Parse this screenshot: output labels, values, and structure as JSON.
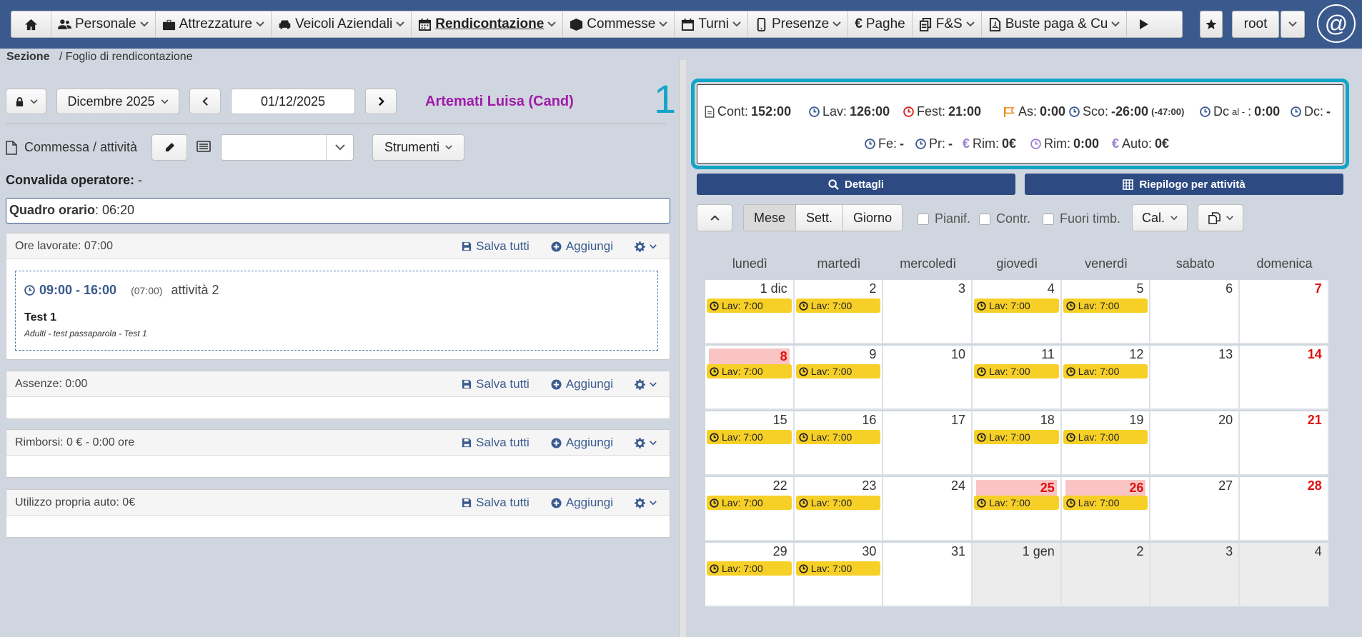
{
  "nav": {
    "items": [
      {
        "label": "Personale",
        "icon": "users-icon"
      },
      {
        "label": "Attrezzature",
        "icon": "toolbox-icon"
      },
      {
        "label": "Veicoli Aziendali",
        "icon": "car-icon"
      },
      {
        "label": "Rendicontazione",
        "icon": "calendar-icon",
        "active": true
      },
      {
        "label": "Commesse",
        "icon": "cube-icon"
      },
      {
        "label": "Turni",
        "icon": "calendar-o-icon"
      },
      {
        "label": "Presenze",
        "icon": "mobile-icon"
      },
      {
        "label": "Paghe",
        "icon": "euro-icon"
      },
      {
        "label": "F&S",
        "icon": "files-icon"
      },
      {
        "label": "Buste paga & Cu",
        "icon": "pdf-icon"
      }
    ],
    "user": "root",
    "at_symbol": "@"
  },
  "breadcrumb": {
    "section": "Sezione",
    "page": "/ Foglio di rendicontazione"
  },
  "left": {
    "month": "Dicembre 2025",
    "date": "01/12/2025",
    "employee": "Artemati Luisa (Cand)",
    "commessa_label": "Commessa / attività",
    "tools_label": "Strumenti",
    "convalida_label": "Convalida operatore:",
    "convalida_value": "-",
    "quadro_label": "Quadro orario",
    "quadro_value": ": 06:20",
    "save_all": "Salva tutti",
    "add": "Aggiungi",
    "panels": {
      "ore": "Ore lavorate: 07:00",
      "assenze": "Assenze: 0:00",
      "rimborsi": "Rimborsi: 0 € - 0:00 ore",
      "auto": "Utilizzo propria auto: 0€"
    },
    "entry": {
      "time": "09:00 - 16:00",
      "duration": "(07:00)",
      "activity": "attività 2",
      "title": "Test 1",
      "subtitle": "Adulti - test passaparola - Test 1"
    }
  },
  "summary": {
    "marker": "1",
    "cont_label": "Cont:",
    "cont": "152:00",
    "lav_label": "Lav:",
    "lav": "126:00",
    "fest_label": "Fest:",
    "fest": "21:00",
    "as_label": "As:",
    "as": "0:00",
    "sco_label": "Sco:",
    "sco": "-26:00",
    "sco_extra": "(-47:00)",
    "dcal_label": "Dc",
    "dcal_small": "al -",
    "dcal_colon": ":",
    "dcal": "0:00",
    "dc_label": "Dc:",
    "dc": "-",
    "fe_label": "Fe:",
    "fe": "-",
    "pr_label": "Pr:",
    "pr": "-",
    "rim1_label": "Rim:",
    "rim1": "0€",
    "rim2_label": "Rim:",
    "rim2": "0:00",
    "auto_label": "Auto:",
    "auto": "0€",
    "colors": {
      "blue": "#3a5a8e",
      "red": "#d22",
      "orange": "#f08a1c",
      "purple": "#9b7fd0"
    }
  },
  "right": {
    "details": "Dettagli",
    "riepilogo": "Riepilogo per attività",
    "views": [
      "Mese",
      "Sett.",
      "Giorno"
    ],
    "checks": [
      "Pianif.",
      "Contr.",
      "Fuori timb."
    ],
    "cal_btn": "Cal."
  },
  "calendar": {
    "weekdays": [
      "lunedì",
      "martedì",
      "mercoledì",
      "giovedì",
      "venerdì",
      "sabato",
      "domenica"
    ],
    "event_label": "Lav: 7:00",
    "weeks": [
      [
        {
          "d": "1 dic",
          "ev": true
        },
        {
          "d": "2",
          "ev": true
        },
        {
          "d": "3"
        },
        {
          "d": "4",
          "ev": true
        },
        {
          "d": "5",
          "ev": true
        },
        {
          "d": "6"
        },
        {
          "d": "7",
          "red": true
        }
      ],
      [
        {
          "d": "8",
          "ev": true,
          "hol": true
        },
        {
          "d": "9",
          "ev": true
        },
        {
          "d": "10"
        },
        {
          "d": "11",
          "ev": true
        },
        {
          "d": "12",
          "ev": true
        },
        {
          "d": "13"
        },
        {
          "d": "14",
          "red": true
        }
      ],
      [
        {
          "d": "15",
          "ev": true
        },
        {
          "d": "16",
          "ev": true
        },
        {
          "d": "17"
        },
        {
          "d": "18",
          "ev": true
        },
        {
          "d": "19",
          "ev": true
        },
        {
          "d": "20"
        },
        {
          "d": "21",
          "red": true
        }
      ],
      [
        {
          "d": "22",
          "ev": true
        },
        {
          "d": "23",
          "ev": true
        },
        {
          "d": "24"
        },
        {
          "d": "25",
          "ev": true,
          "hol": true
        },
        {
          "d": "26",
          "ev": true,
          "hol": true
        },
        {
          "d": "27"
        },
        {
          "d": "28",
          "red": true
        }
      ],
      [
        {
          "d": "29",
          "ev": true
        },
        {
          "d": "30",
          "ev": true
        },
        {
          "d": "31"
        },
        {
          "d": "1 gen",
          "other": true
        },
        {
          "d": "2",
          "other": true
        },
        {
          "d": "3",
          "other": true
        },
        {
          "d": "4",
          "other": true
        }
      ]
    ]
  }
}
